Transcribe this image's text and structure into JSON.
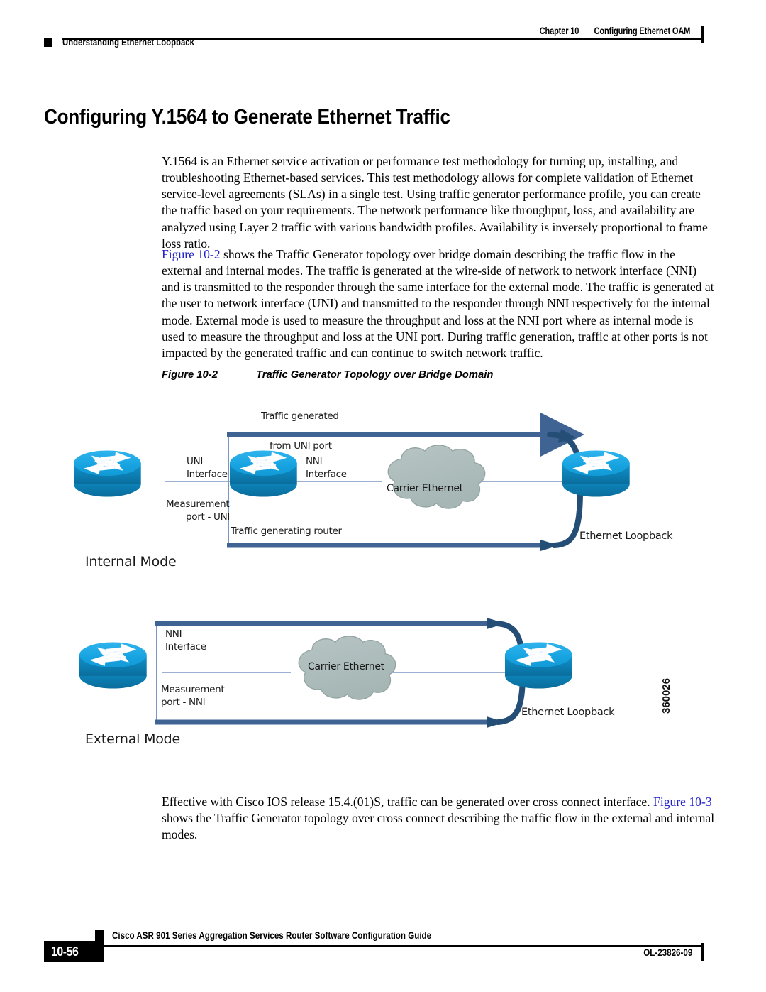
{
  "header": {
    "chapter_number": "Chapter 10",
    "chapter_title": "Configuring Ethernet OAM",
    "section_title": "Understanding Ethernet Loopback"
  },
  "title": "Configuring Y.1564 to Generate Ethernet Traffic",
  "paragraphs": {
    "p1": "Y.1564 is an Ethernet service activation or performance test methodology for turning up, installing, and troubleshooting Ethernet-based services. This test methodology allows for complete validation of Ethernet service-level agreements (SLAs) in a single test. Using traffic generator performance profile, you can create the traffic based on your requirements. The network performance like throughput, loss, and availability are analyzed using Layer 2 traffic with various bandwidth profiles. Availability is inversely proportional to frame loss ratio.",
    "p2_xref": "Figure 10-2",
    "p2_rest": " shows the Traffic Generator topology over bridge domain describing the traffic flow in the external and internal modes. The traffic is generated at the wire-side of network to network interface (NNI) and is transmitted to the responder through the same interface for the external mode. The traffic is generated at the user to network interface (UNI) and transmitted to the responder through NNI respectively for the internal mode. External mode is used to measure the throughput and loss at the NNI port where as internal mode is used to measure the throughput and loss at the UNI port. During traffic generation, traffic at other ports is not impacted by the generated traffic and can continue to switch network traffic.",
    "p3_lead": "Effective with Cisco IOS release 15.4.(01)S, traffic can be generated over cross connect interface. ",
    "p3_xref": "Figure 10-3",
    "p3_rest": " shows the Traffic Generator topology over cross connect describing the traffic flow in the external and internal modes."
  },
  "figure": {
    "label": "Figure 10-2",
    "caption": "Traffic Generator Topology over Bridge Domain",
    "art_number": "360026",
    "internal": {
      "mode_label": "Internal Mode",
      "traffic_generated": "Traffic generated",
      "from_uni_port": "from UNI port",
      "uni_interface_line1": "UNI",
      "uni_interface_line2": "Interface",
      "nni_interface_line1": "NNI",
      "nni_interface_line2": "Interface",
      "measurement_line1": "Measurement",
      "measurement_line2": "port - UNI",
      "traffic_generating_router": "Traffic generating router",
      "carrier_ethernet": "Carrier Ethernet",
      "ethernet_loopback": "Ethernet Loopback"
    },
    "external": {
      "mode_label": "External Mode",
      "nni_interface_line1": "NNI",
      "nni_interface_line2": "Interface",
      "measurement_line1": "Measurement",
      "measurement_line2": "port - NNI",
      "carrier_ethernet": "Carrier Ethernet",
      "ethernet_loopback": "Ethernet Loopback"
    },
    "colors": {
      "router_top": "#17A3E0",
      "router_side": "#0C7FB4",
      "cloud_fill": "#AFBFBF",
      "cloud_stroke": "#8E9E9E",
      "flow_arrow": "#3F6493",
      "loop_arrow": "#254E77",
      "thin_link": "#7B95C4"
    }
  },
  "footer": {
    "guide_title": "Cisco ASR 901 Series Aggregation Services Router Software Configuration Guide",
    "page_number": "10-56",
    "doc_id": "OL-23826-09"
  }
}
